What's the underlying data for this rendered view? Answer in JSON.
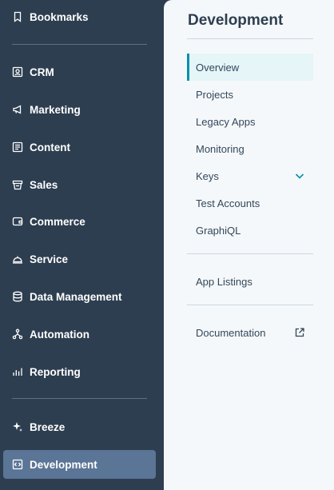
{
  "sidebar": {
    "bookmarks": "Bookmarks",
    "items": [
      "CRM",
      "Marketing",
      "Content",
      "Sales",
      "Commerce",
      "Service",
      "Data Management",
      "Automation",
      "Reporting"
    ],
    "breeze": "Breeze",
    "development": "Development"
  },
  "panel": {
    "title": "Development",
    "items": [
      "Overview",
      "Projects",
      "Legacy Apps",
      "Monitoring",
      "Keys",
      "Test Accounts",
      "GraphiQL"
    ],
    "app_listings": "App Listings",
    "documentation": "Documentation"
  },
  "colors": {
    "sidebar_bg": "#2d3e50",
    "active_item": "#5b7596",
    "panel_bg": "#f5f8fa",
    "accent": "#0091ae"
  }
}
